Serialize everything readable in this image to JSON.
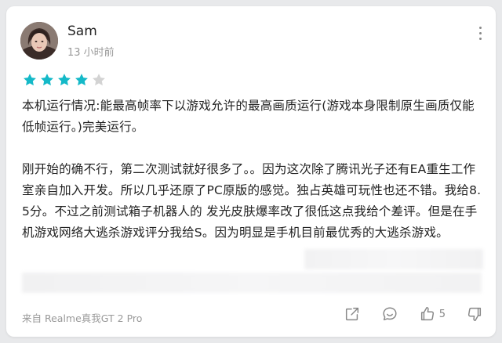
{
  "review": {
    "username": "Sam",
    "time_ago": "13 小时前",
    "rating": 4,
    "rating_max": 5,
    "paragraphs": [
      "本机运行情况:能最高帧率下以游戏允许的最高画质运行(游戏本身限制原生画质仅能低帧运行。)完美运行。",
      "刚开始的确不行，第二次测试就好很多了。。因为这次除了腾讯光子还有EA重生工作室亲自加入开发。所以几乎还原了PC原版的感觉。独占英雄可玩性也还不错。我给8.5分。不过之前测试箱子机器人的 发光皮肤爆率改了很低这点我给个差评。但是在手机游戏网络大逃杀游戏评分我给S。因为明显是手机目前最优秀的大逃杀游戏。"
    ],
    "device": "来自 Realme真我GT 2 Pro",
    "like_count": "5"
  },
  "colors": {
    "star_filled": "#14b9c8",
    "star_empty": "#d3d3d3",
    "icon": "#888888",
    "text_secondary": "#999999"
  },
  "icons": {
    "more": "more-vertical-icon",
    "share": "share-icon",
    "comment": "comment-icon",
    "like": "thumbs-up-icon",
    "dislike": "thumbs-down-icon"
  }
}
